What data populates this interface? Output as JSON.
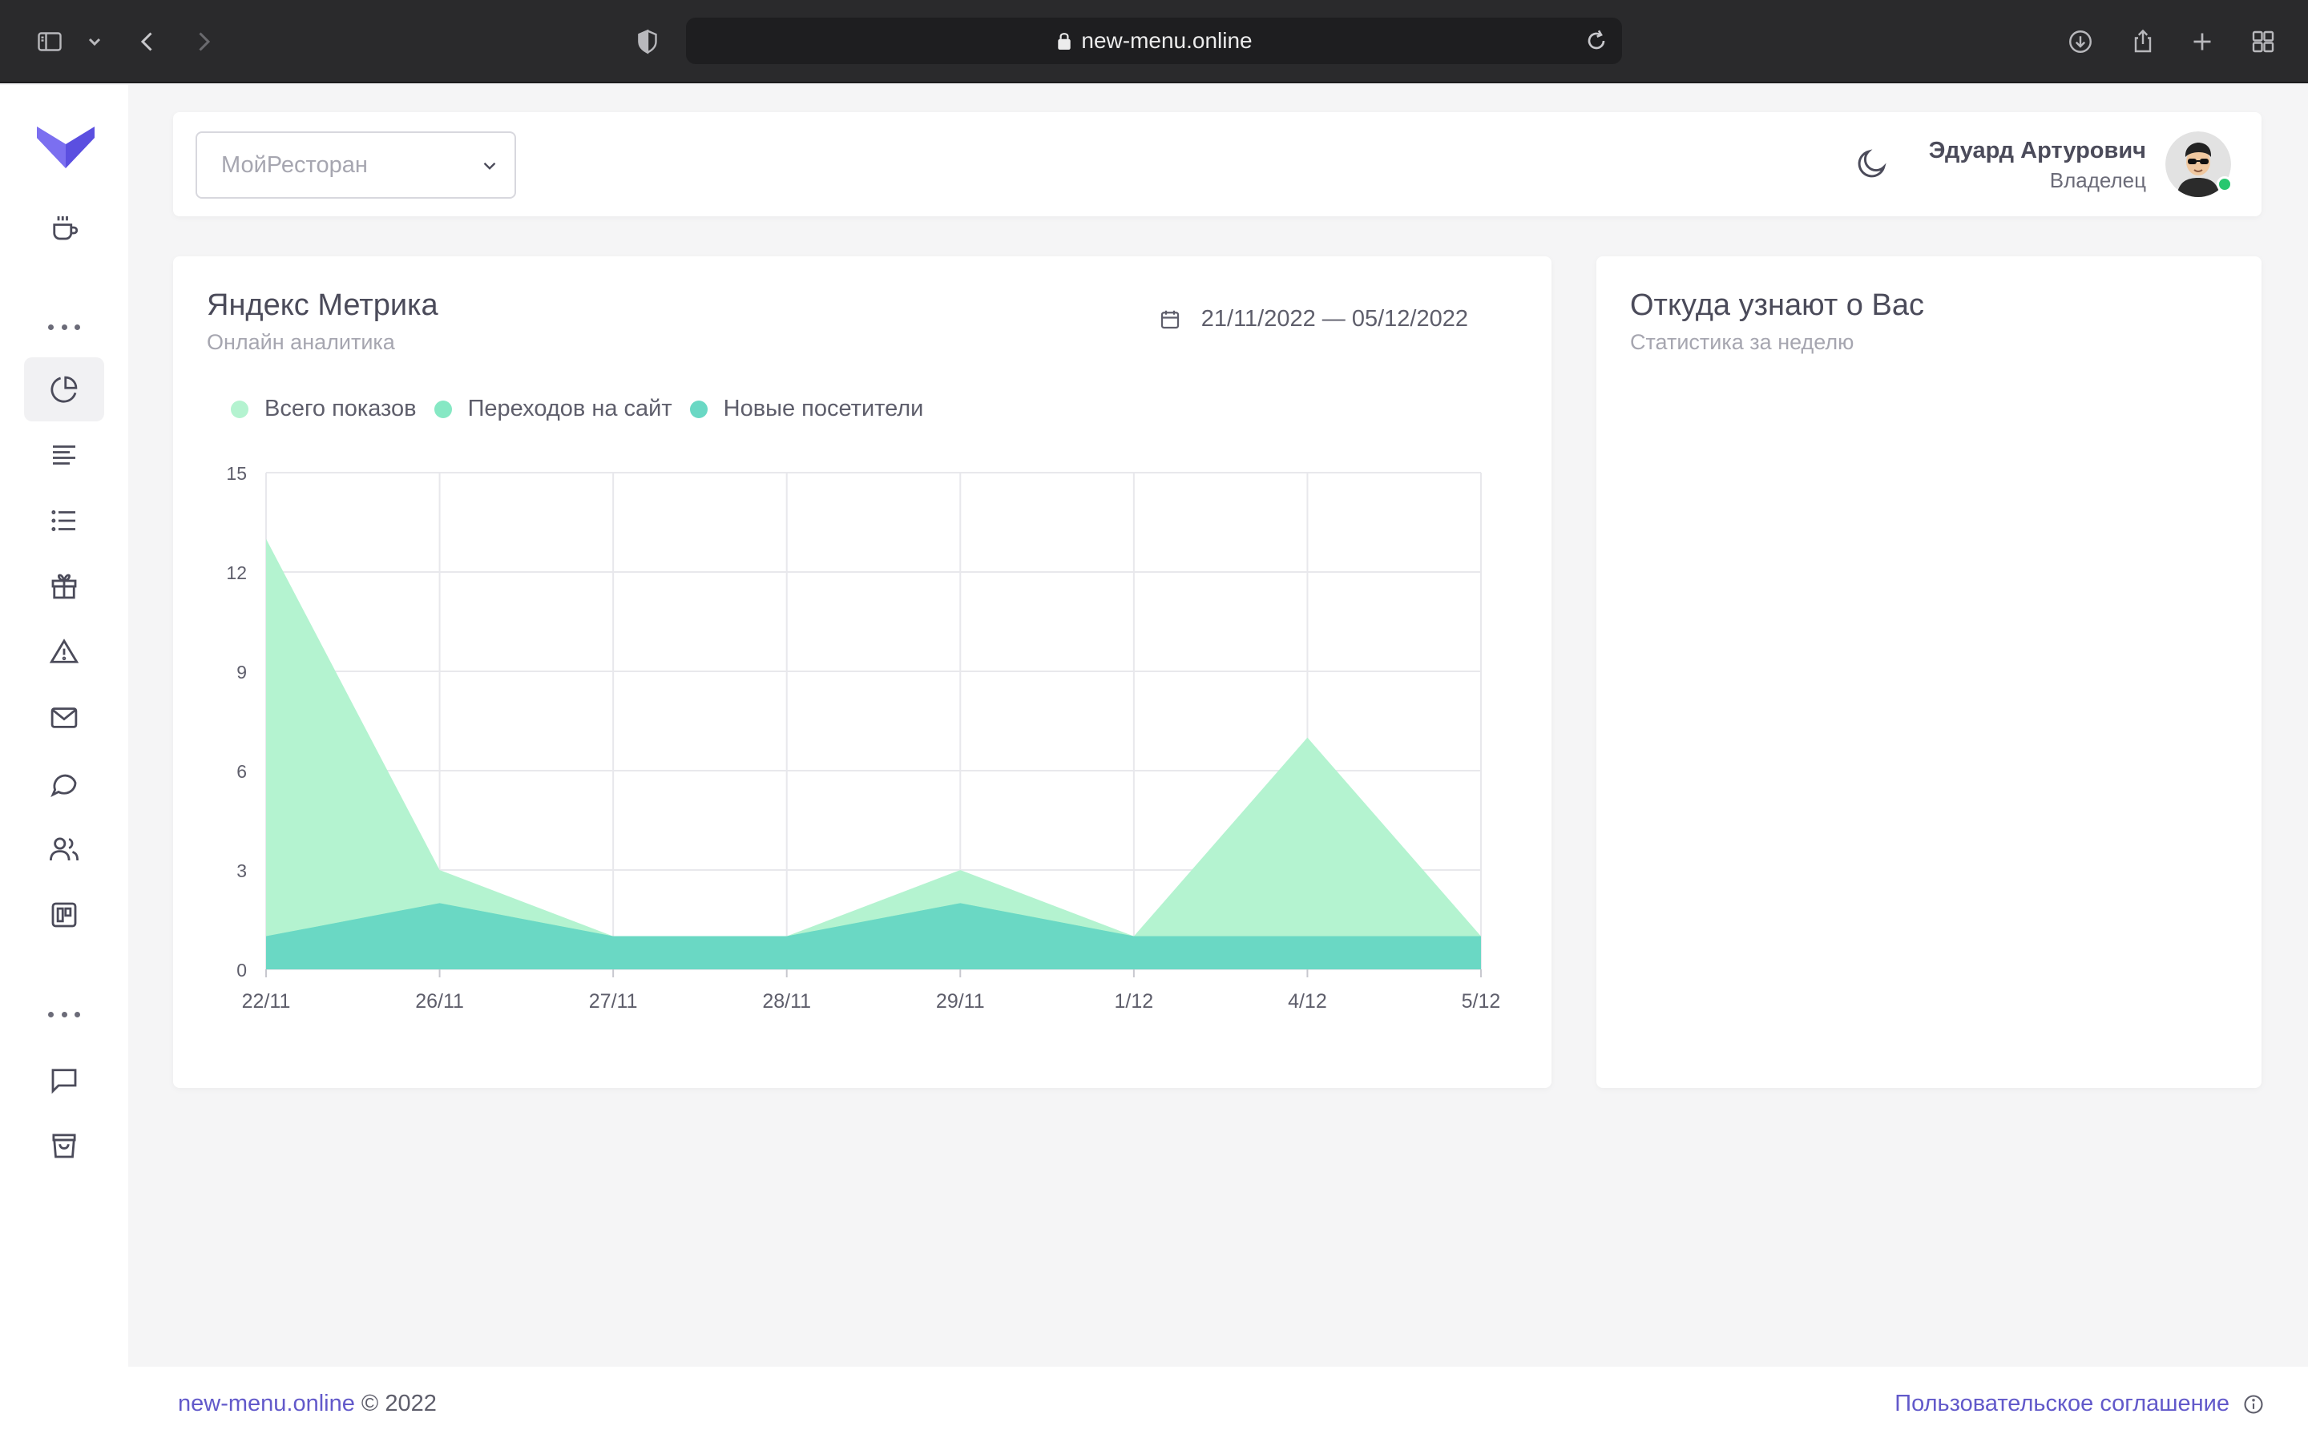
{
  "browser": {
    "url": "new-menu.online"
  },
  "header": {
    "restaurant_select": "МойРесторан",
    "user_name": "Эдуард Артурович",
    "user_role": "Владелец"
  },
  "metrics_card": {
    "title": "Яндекс Метрика",
    "subtitle": "Онлайн аналитика",
    "date_range": "21/11/2022 — 05/12/2022"
  },
  "sources_card": {
    "title": "Откуда узнают о Вас",
    "subtitle": "Статистика за неделю"
  },
  "chart_data": {
    "type": "area",
    "categories": [
      "22/11",
      "26/11",
      "27/11",
      "28/11",
      "29/11",
      "1/12",
      "4/12",
      "5/12"
    ],
    "yticks": [
      "0",
      "3",
      "6",
      "9",
      "12",
      "15"
    ],
    "ylim": [
      0,
      15
    ],
    "grid": true,
    "legend_position": "top-left",
    "series": [
      {
        "name": "Всего показов",
        "color": "#b4f3d0",
        "values": [
          13,
          3,
          1,
          1,
          3,
          1,
          7,
          1
        ]
      },
      {
        "name": "Переходов на сайт",
        "color": "#86e8c4",
        "values": [
          1,
          2,
          1,
          1,
          2,
          1,
          1,
          1
        ]
      },
      {
        "name": "Новые посетители",
        "color": "#6ad8c4",
        "values": [
          1,
          2,
          1,
          1,
          2,
          1,
          1,
          1
        ]
      }
    ]
  },
  "footer": {
    "site_link": "new-menu.online",
    "copyright": " © 2022",
    "agreement": "Пользовательское соглашение"
  },
  "colors": {
    "accent": "#6259ca",
    "online": "#28c76f"
  }
}
